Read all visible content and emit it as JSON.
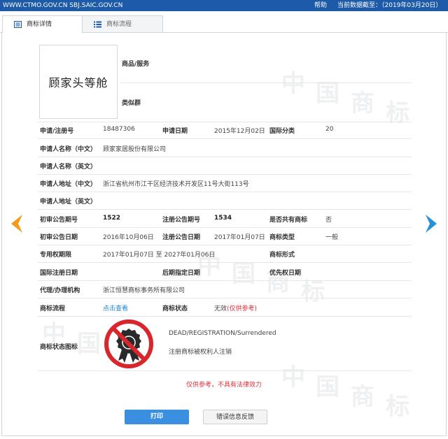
{
  "header": {
    "site": "WWW.CTMO.GOV.CN SBJ.SAIC.GOV.CN",
    "help": "帮助",
    "data_as_of": "当前数据截至：（2019年03月20日）"
  },
  "tabs": [
    {
      "label": "商标详情",
      "active": true
    },
    {
      "label": "商标流程",
      "active": false
    }
  ],
  "watermark": [
    "中",
    "国",
    "商",
    "标"
  ],
  "trademark": {
    "mark_text": "顾家头等舱",
    "goods_services_label": "商品/服务",
    "similar_group_label": "类似群"
  },
  "fields": {
    "reg_no_label": "申请/注册号",
    "reg_no": "18487306",
    "app_date_label": "申请日期",
    "app_date": "2015年12月02日",
    "intl_class_label": "国际分类",
    "intl_class": "20",
    "applicant_cn_label": "申请人名称（中文）",
    "applicant_cn": "顾家家居股份有限公司",
    "applicant_en_label": "申请人名称（英文）",
    "address_cn_label": "申请人地址（中文）",
    "address_cn": "浙江省杭州市江干区经济技术开发区11号大街113号",
    "address_en_label": "申请人地址（英文）",
    "prelim_issue_label": "初审公告期号",
    "prelim_issue": "1522",
    "reg_issue_label": "注册公告期号",
    "reg_issue": "1534",
    "shared_label": "是否共有商标",
    "shared": "否",
    "prelim_date_label": "初审公告日期",
    "prelim_date": "2016年10月06日",
    "reg_date_label": "注册公告日期",
    "reg_date": "2017年01月07日",
    "mark_type_label": "商标类型",
    "mark_type": "一般",
    "exclusive_label": "专用权期限",
    "exclusive_period": "2017年01月07日 至 2027年01月06日",
    "mark_form_label": "商标形式",
    "intl_reg_date_label": "国际注册日期",
    "later_designation_label": "后期指定日期",
    "priority_date_label": "优先权日期",
    "agent_label": "代理/办理机构",
    "agent": "浙江恒慧商标事务所有限公司",
    "process_label": "商标流程",
    "process_link": "点击查看",
    "status_label": "商标状态",
    "status_value": "无效",
    "status_note": "(仅供参考)",
    "status_icon_label": "商标状态图标"
  },
  "status_icon": {
    "text_en": "DEAD/REGISTRATION/Surrendered",
    "text_cn": "注册商标被权利人注销"
  },
  "disclaimer": "仅供参考，不具有法律效力",
  "buttons": {
    "print": "打印",
    "feedback": "错误信息反馈"
  },
  "colors": {
    "header_bg": "#1d5aa8",
    "link": "#1e88d6",
    "warning": "#e0303a",
    "arrow_left": "#f29b1d",
    "arrow_right": "#2b8fd6"
  }
}
